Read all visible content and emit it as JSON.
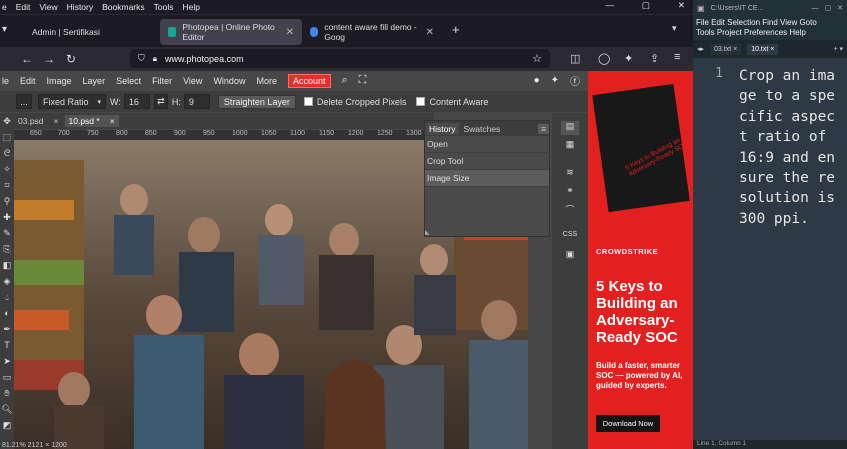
{
  "browser": {
    "menu": [
      "Edit",
      "View",
      "History",
      "Bookmarks",
      "Tools",
      "Help"
    ],
    "menu_first_partial": "e",
    "tabs": [
      {
        "title": "Admin | Sertifikasi",
        "active": false,
        "favicon_color": "#1c1b22"
      },
      {
        "title": "Photopea | Online Photo Editor",
        "active": true,
        "favicon_color": "#18a497"
      },
      {
        "title": "content aware fill demo - Goog",
        "active": false,
        "favicon_color": "#4285f4"
      }
    ],
    "new_tab_label": "+",
    "url": "www.photopea.com",
    "window_controls": [
      "—",
      "▢",
      "✕"
    ]
  },
  "photopea": {
    "menu": [
      "le",
      "Edit",
      "Image",
      "Layer",
      "Select",
      "Filter",
      "View",
      "Window",
      "More"
    ],
    "account_label": "Account",
    "options": {
      "more_label": "...",
      "ratio_select": "Fixed Ratio",
      "w_label": "W:",
      "w_value": "16",
      "swap_label": "⇄",
      "h_label": "H:",
      "h_value": "9",
      "straighten_label": "Straighten Layer",
      "delete_cropped_label": "Delete Cropped Pixels",
      "content_aware_label": "Content Aware"
    },
    "doc_tabs": [
      {
        "name": "03.psd",
        "close": "×",
        "active": false
      },
      {
        "name": "10.psd *",
        "close": "×",
        "active": true
      }
    ],
    "ruler_ticks": [
      "650",
      "700",
      "750",
      "800",
      "850",
      "900",
      "950",
      "1000",
      "1050",
      "1100",
      "1150",
      "1200",
      "1250",
      "1300"
    ],
    "history_panel": {
      "tabs": [
        "History",
        "Swatches"
      ],
      "items": [
        "Open",
        "Crop Tool",
        "Image Size"
      ],
      "selected_index": 2
    },
    "right_labels": [
      "CSS"
    ],
    "status_text": "81.21%   2121 × 1200"
  },
  "ad": {
    "book_text": "5 Keys to Building an Adversary-Ready SOC",
    "logo": "CROWDSTRIKE",
    "headline": "5 Keys to Building an Adversary-Ready SOC",
    "sub": "Build a faster, smarter SOC — powered by AI, guided by experts.",
    "button": "Download Now"
  },
  "editor": {
    "title": "C:\\Users\\IT CE...",
    "menu_line1": "File   Edit   Selection   Find   View   Goto",
    "menu_line2": "Tools   Project   Preferences   Help",
    "tabs": [
      {
        "name": "03.txt",
        "close": "×",
        "active": false
      },
      {
        "name": "10.txt",
        "close": "×",
        "active": true
      }
    ],
    "line_number": "1",
    "content": "Crop an image to a specific aspect ratio of 16:9 and ensure the resolution is 300 ppi.",
    "status": "Line 1, Column 1"
  }
}
